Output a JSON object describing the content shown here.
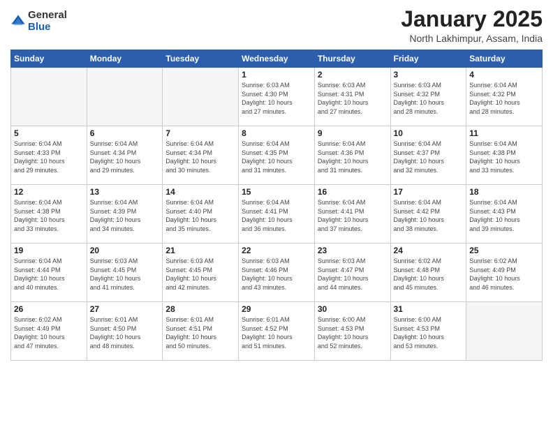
{
  "logo": {
    "general": "General",
    "blue": "Blue"
  },
  "title": "January 2025",
  "location": "North Lakhimpur, Assam, India",
  "days_header": [
    "Sunday",
    "Monday",
    "Tuesday",
    "Wednesday",
    "Thursday",
    "Friday",
    "Saturday"
  ],
  "weeks": [
    [
      {
        "day": "",
        "info": ""
      },
      {
        "day": "",
        "info": ""
      },
      {
        "day": "",
        "info": ""
      },
      {
        "day": "1",
        "info": "Sunrise: 6:03 AM\nSunset: 4:30 PM\nDaylight: 10 hours\nand 27 minutes."
      },
      {
        "day": "2",
        "info": "Sunrise: 6:03 AM\nSunset: 4:31 PM\nDaylight: 10 hours\nand 27 minutes."
      },
      {
        "day": "3",
        "info": "Sunrise: 6:03 AM\nSunset: 4:32 PM\nDaylight: 10 hours\nand 28 minutes."
      },
      {
        "day": "4",
        "info": "Sunrise: 6:04 AM\nSunset: 4:32 PM\nDaylight: 10 hours\nand 28 minutes."
      }
    ],
    [
      {
        "day": "5",
        "info": "Sunrise: 6:04 AM\nSunset: 4:33 PM\nDaylight: 10 hours\nand 29 minutes."
      },
      {
        "day": "6",
        "info": "Sunrise: 6:04 AM\nSunset: 4:34 PM\nDaylight: 10 hours\nand 29 minutes."
      },
      {
        "day": "7",
        "info": "Sunrise: 6:04 AM\nSunset: 4:34 PM\nDaylight: 10 hours\nand 30 minutes."
      },
      {
        "day": "8",
        "info": "Sunrise: 6:04 AM\nSunset: 4:35 PM\nDaylight: 10 hours\nand 31 minutes."
      },
      {
        "day": "9",
        "info": "Sunrise: 6:04 AM\nSunset: 4:36 PM\nDaylight: 10 hours\nand 31 minutes."
      },
      {
        "day": "10",
        "info": "Sunrise: 6:04 AM\nSunset: 4:37 PM\nDaylight: 10 hours\nand 32 minutes."
      },
      {
        "day": "11",
        "info": "Sunrise: 6:04 AM\nSunset: 4:38 PM\nDaylight: 10 hours\nand 33 minutes."
      }
    ],
    [
      {
        "day": "12",
        "info": "Sunrise: 6:04 AM\nSunset: 4:38 PM\nDaylight: 10 hours\nand 33 minutes."
      },
      {
        "day": "13",
        "info": "Sunrise: 6:04 AM\nSunset: 4:39 PM\nDaylight: 10 hours\nand 34 minutes."
      },
      {
        "day": "14",
        "info": "Sunrise: 6:04 AM\nSunset: 4:40 PM\nDaylight: 10 hours\nand 35 minutes."
      },
      {
        "day": "15",
        "info": "Sunrise: 6:04 AM\nSunset: 4:41 PM\nDaylight: 10 hours\nand 36 minutes."
      },
      {
        "day": "16",
        "info": "Sunrise: 6:04 AM\nSunset: 4:41 PM\nDaylight: 10 hours\nand 37 minutes."
      },
      {
        "day": "17",
        "info": "Sunrise: 6:04 AM\nSunset: 4:42 PM\nDaylight: 10 hours\nand 38 minutes."
      },
      {
        "day": "18",
        "info": "Sunrise: 6:04 AM\nSunset: 4:43 PM\nDaylight: 10 hours\nand 39 minutes."
      }
    ],
    [
      {
        "day": "19",
        "info": "Sunrise: 6:04 AM\nSunset: 4:44 PM\nDaylight: 10 hours\nand 40 minutes."
      },
      {
        "day": "20",
        "info": "Sunrise: 6:03 AM\nSunset: 4:45 PM\nDaylight: 10 hours\nand 41 minutes."
      },
      {
        "day": "21",
        "info": "Sunrise: 6:03 AM\nSunset: 4:45 PM\nDaylight: 10 hours\nand 42 minutes."
      },
      {
        "day": "22",
        "info": "Sunrise: 6:03 AM\nSunset: 4:46 PM\nDaylight: 10 hours\nand 43 minutes."
      },
      {
        "day": "23",
        "info": "Sunrise: 6:03 AM\nSunset: 4:47 PM\nDaylight: 10 hours\nand 44 minutes."
      },
      {
        "day": "24",
        "info": "Sunrise: 6:02 AM\nSunset: 4:48 PM\nDaylight: 10 hours\nand 45 minutes."
      },
      {
        "day": "25",
        "info": "Sunrise: 6:02 AM\nSunset: 4:49 PM\nDaylight: 10 hours\nand 46 minutes."
      }
    ],
    [
      {
        "day": "26",
        "info": "Sunrise: 6:02 AM\nSunset: 4:49 PM\nDaylight: 10 hours\nand 47 minutes."
      },
      {
        "day": "27",
        "info": "Sunrise: 6:01 AM\nSunset: 4:50 PM\nDaylight: 10 hours\nand 48 minutes."
      },
      {
        "day": "28",
        "info": "Sunrise: 6:01 AM\nSunset: 4:51 PM\nDaylight: 10 hours\nand 50 minutes."
      },
      {
        "day": "29",
        "info": "Sunrise: 6:01 AM\nSunset: 4:52 PM\nDaylight: 10 hours\nand 51 minutes."
      },
      {
        "day": "30",
        "info": "Sunrise: 6:00 AM\nSunset: 4:53 PM\nDaylight: 10 hours\nand 52 minutes."
      },
      {
        "day": "31",
        "info": "Sunrise: 6:00 AM\nSunset: 4:53 PM\nDaylight: 10 hours\nand 53 minutes."
      },
      {
        "day": "",
        "info": ""
      }
    ]
  ]
}
